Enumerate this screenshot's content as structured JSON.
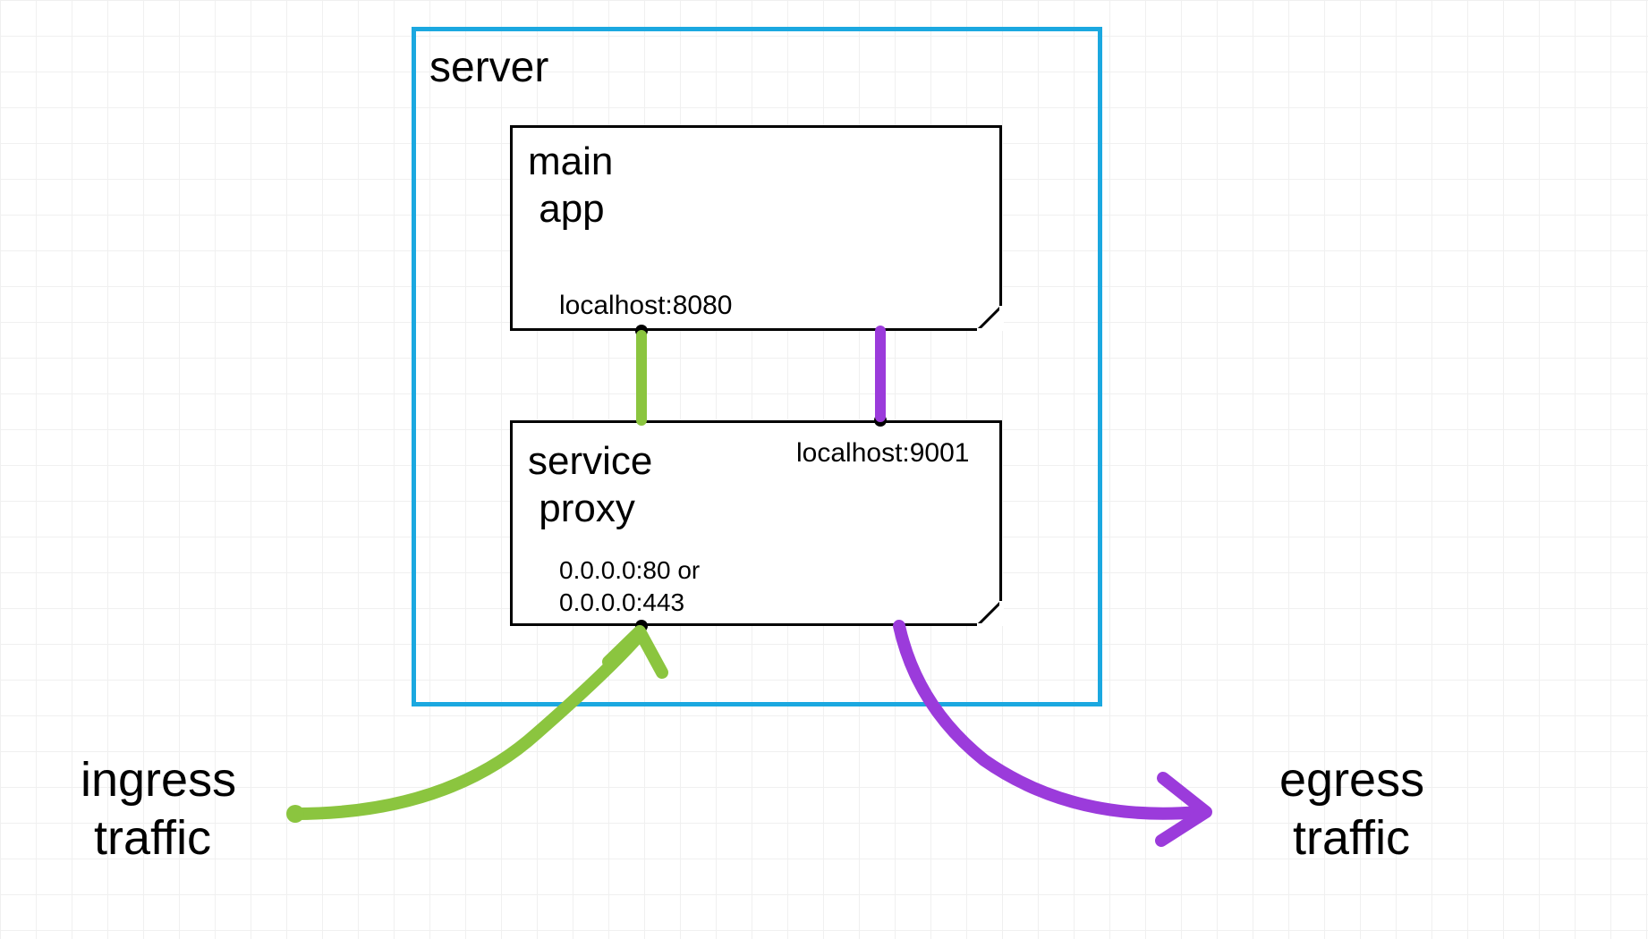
{
  "diagram": {
    "server_label": "server",
    "main_app": {
      "title_line1": "main",
      "title_line2": "app",
      "port": "localhost:8080"
    },
    "proxy": {
      "title_line1": "service",
      "title_line2": "proxy",
      "port_inbound": "localhost:9001",
      "external_port_line1": "0.0.0.0:80  or",
      "external_port_line2": "0.0.0.0:443"
    },
    "ingress": {
      "label_line1": "ingress",
      "label_line2": "traffic"
    },
    "egress": {
      "label_line1": "egress",
      "label_line2": "traffic"
    }
  },
  "colors": {
    "server_border": "#1ba8e0",
    "ingress_arrow": "#8bc53f",
    "egress_arrow": "#9b3bdb"
  }
}
